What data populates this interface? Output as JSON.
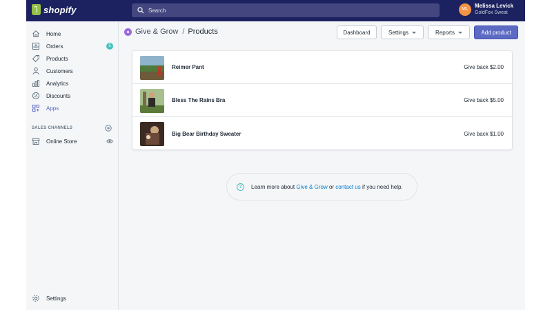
{
  "brand": {
    "name": "shopify"
  },
  "search": {
    "placeholder": "Search"
  },
  "user": {
    "initials": "ML",
    "name": "Melissa Levick",
    "store": "GoldFox Sweat"
  },
  "sidebar": {
    "items": [
      {
        "label": "Home",
        "icon": "home-icon"
      },
      {
        "label": "Orders",
        "icon": "orders-icon",
        "badge": "5"
      },
      {
        "label": "Products",
        "icon": "tag-icon"
      },
      {
        "label": "Customers",
        "icon": "person-icon"
      },
      {
        "label": "Analytics",
        "icon": "bar-chart-icon"
      },
      {
        "label": "Discounts",
        "icon": "discount-icon"
      },
      {
        "label": "Apps",
        "icon": "apps-icon",
        "active": true
      }
    ],
    "sales_channels_title": "SALES CHANNELS",
    "channels": [
      {
        "label": "Online Store",
        "icon": "store-icon"
      }
    ],
    "settings_label": "Settings"
  },
  "header": {
    "app_name": "Give & Grow",
    "separator": "/",
    "title": "Products",
    "buttons": {
      "dashboard": "Dashboard",
      "settings": "Settings",
      "reports": "Reports",
      "add_product": "Add product"
    }
  },
  "products": [
    {
      "name": "Reimer Pant",
      "give_back": "Give back $2.00"
    },
    {
      "name": "Bless The Rains Bra",
      "give_back": "Give back $5.00"
    },
    {
      "name": "Big Bear Birthday Sweater",
      "give_back": "Give back $1.00"
    }
  ],
  "help": {
    "prefix": "Learn more about ",
    "link1": "Give & Grow",
    "middle": " or ",
    "link2": "contact us",
    "suffix": " if you need help.",
    "icon": "?"
  },
  "colors": {
    "topbar": "#1c2260",
    "accent": "#5c6ac4",
    "badge": "#47c1bf",
    "link": "#007ace"
  }
}
